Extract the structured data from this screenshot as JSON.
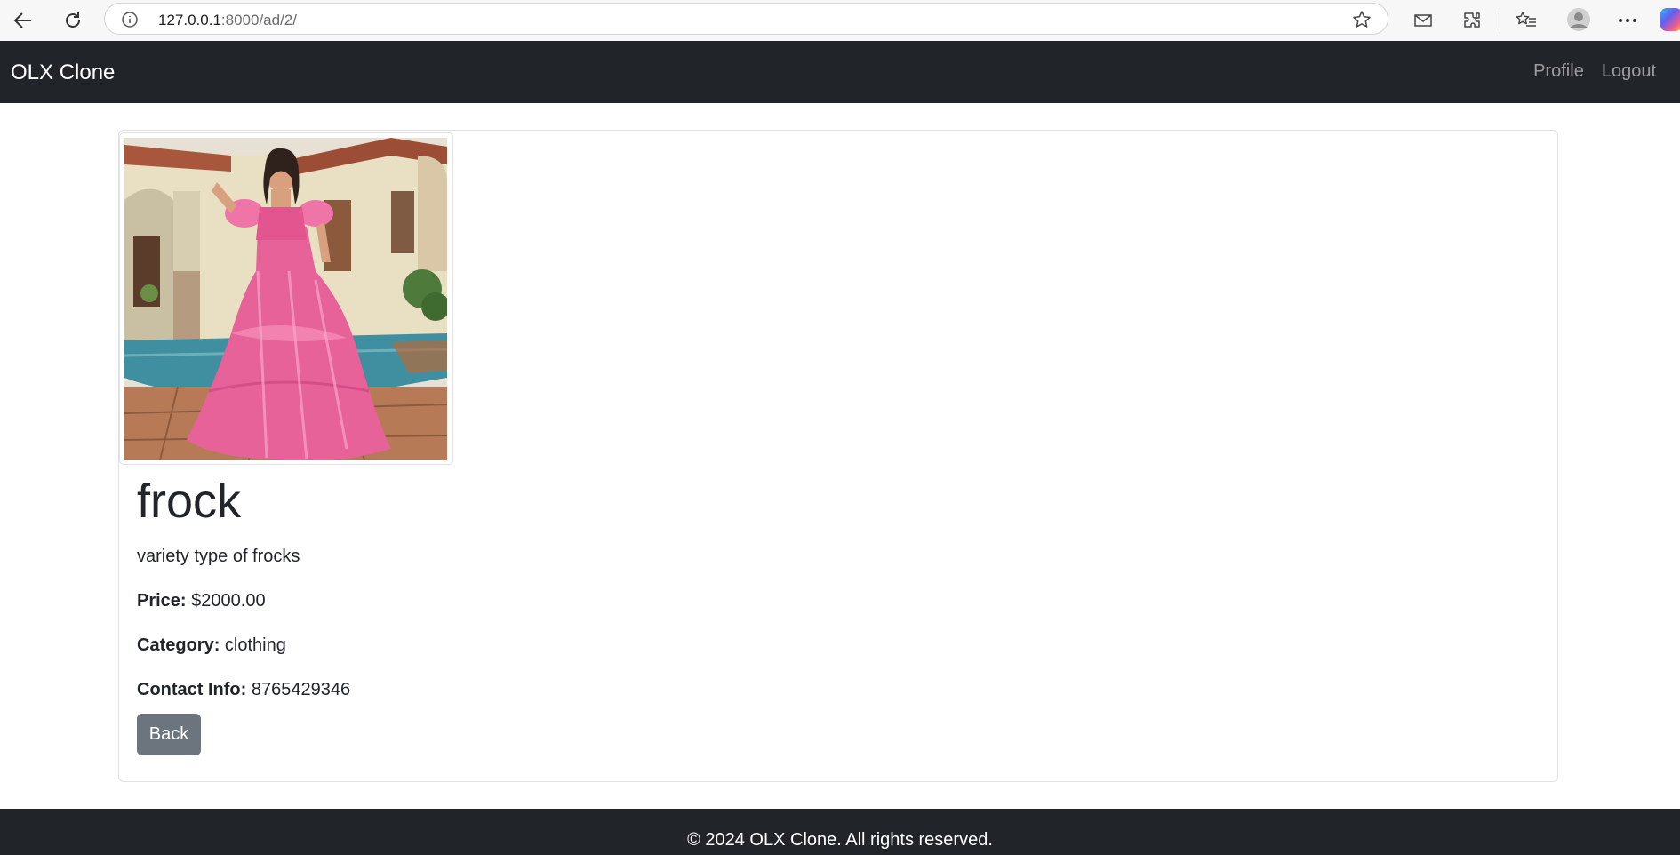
{
  "browser": {
    "url_host": "127.0.0.1",
    "url_rest": ":8000/ad/2/",
    "icons": {
      "back": "arrow-left-icon",
      "reload": "reload-icon",
      "info": "info-icon",
      "favorite": "star-icon",
      "mail": "mail-icon",
      "extensions": "puzzle-icon",
      "favorites": "favorites-list-icon",
      "profile": "avatar-icon",
      "more": "more-dots-icon",
      "copilot": "copilot-icon"
    }
  },
  "navbar": {
    "brand": "OLX Clone",
    "links": [
      "Profile",
      "Logout"
    ]
  },
  "ad": {
    "image_alt": "frock photo",
    "title": "frock",
    "description": "variety type of frocks",
    "price_label": "Price:",
    "price_value": "$2000.00",
    "category_label": "Category:",
    "category_value": "clothing",
    "contact_label": "Contact Info:",
    "contact_value": "8765429346",
    "back_label": "Back"
  },
  "footer": {
    "text": "© 2024 OLX Clone. All rights reserved."
  },
  "colors": {
    "navbar_bg": "#212529",
    "footer_bg": "#212529",
    "button_secondary": "#6c757d",
    "nav_link": "rgba(255,255,255,0.55)"
  }
}
